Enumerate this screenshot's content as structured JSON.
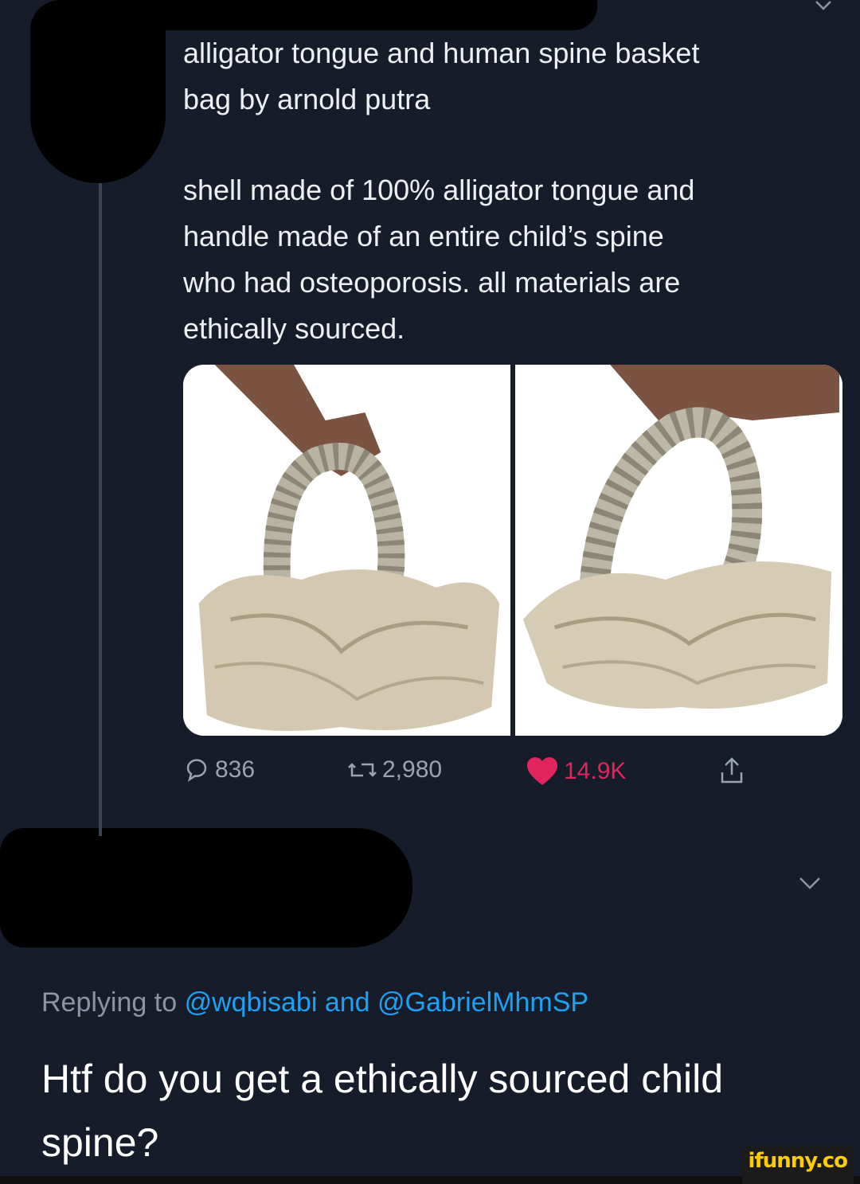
{
  "tweet": {
    "line1": "alligator tongue and human spine basket",
    "line2": "bag by arnold putra",
    "body_lines": [
      "shell made of 100% alligator tongue and",
      "handle made of an entire child’s spine",
      "who had osteoporosis. all materials are",
      "ethically sourced."
    ]
  },
  "actions": {
    "replies": "836",
    "retweets": "2,980",
    "likes": "14.9K"
  },
  "colors": {
    "background": "#161c2a",
    "like": "#e0245e",
    "mention": "#1da1f2",
    "muted": "#8b95a6"
  },
  "reply": {
    "prefix": "Replying to",
    "mention1": "@wqbisabi",
    "conjunction": "and",
    "mention2": "@GabrielMhmSP",
    "text": "Htf do you get a ethically sourced child spine?"
  },
  "watermark": "ifunny.co"
}
